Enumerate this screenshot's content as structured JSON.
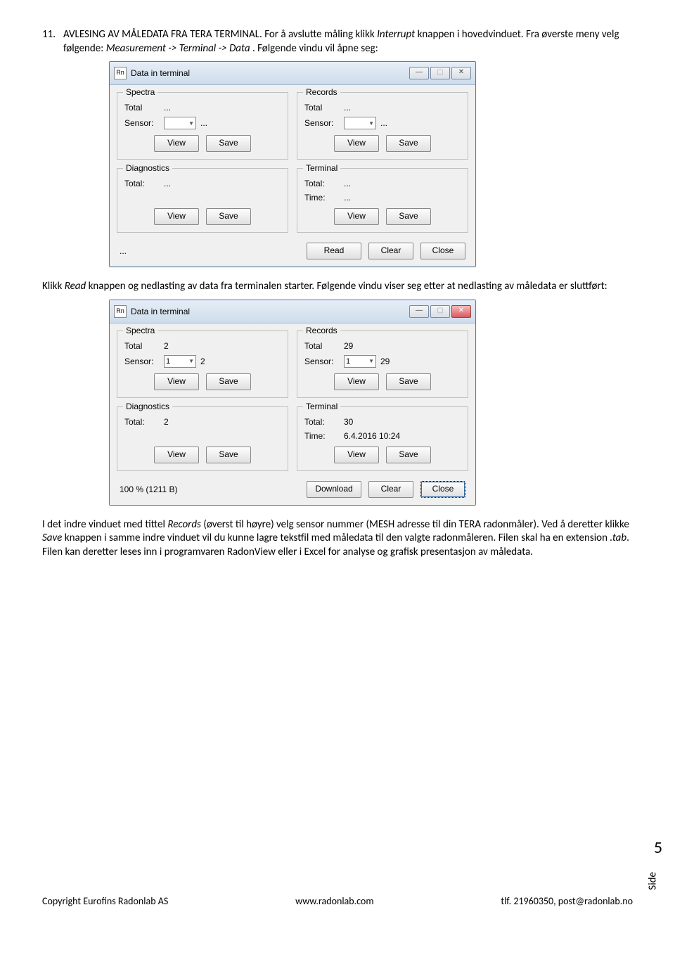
{
  "para1": {
    "num": "11.",
    "t1": "AVLESING AV MÅLEDATA FRA TERA TERMINAL. For å avslutte måling klikk ",
    "i1": "Interrupt",
    "t2": " knappen i hovedvinduet. Fra øverste meny velg følgende: ",
    "i2": "Measurement -> Terminal -> Data",
    "t3": " . Følgende vindu vil åpne seg:"
  },
  "win1": {
    "icon": "Rn",
    "title": "Data in terminal",
    "spectra": {
      "legend": "Spectra",
      "total_lbl": "Total",
      "total_val": "...",
      "sensor_lbl": "Sensor:",
      "sensor_sel": "",
      "sensor_after": "...",
      "view": "View",
      "save": "Save"
    },
    "records": {
      "legend": "Records",
      "total_lbl": "Total",
      "total_val": "...",
      "sensor_lbl": "Sensor:",
      "sensor_sel": "",
      "sensor_after": "...",
      "view": "View",
      "save": "Save"
    },
    "diag": {
      "legend": "Diagnostics",
      "total_lbl": "Total:",
      "total_val": "...",
      "view": "View",
      "save": "Save"
    },
    "term": {
      "legend": "Terminal",
      "total_lbl": "Total:",
      "total_val": "...",
      "time_lbl": "Time:",
      "time_val": "...",
      "view": "View",
      "save": "Save"
    },
    "status": "...",
    "read": "Read",
    "clear": "Clear",
    "close": "Close"
  },
  "para2": {
    "t1": "Klikk ",
    "i1": "Read",
    "t2": " knappen og nedlasting av data fra terminalen starter. Følgende vindu viser seg etter at nedlasting av måledata er sluttført:"
  },
  "win2": {
    "icon": "Rn",
    "title": "Data in terminal",
    "spectra": {
      "legend": "Spectra",
      "total_lbl": "Total",
      "total_val": "2",
      "sensor_lbl": "Sensor:",
      "sensor_sel": "1",
      "sensor_after": "2",
      "view": "View",
      "save": "Save"
    },
    "records": {
      "legend": "Records",
      "total_lbl": "Total",
      "total_val": "29",
      "sensor_lbl": "Sensor:",
      "sensor_sel": "1",
      "sensor_after": "29",
      "view": "View",
      "save": "Save"
    },
    "diag": {
      "legend": "Diagnostics",
      "total_lbl": "Total:",
      "total_val": "2",
      "view": "View",
      "save": "Save"
    },
    "term": {
      "legend": "Terminal",
      "total_lbl": "Total:",
      "total_val": "30",
      "time_lbl": "Time:",
      "time_val": "6.4.2016  10:24",
      "view": "View",
      "save": "Save"
    },
    "status": "100 % (1211 B)",
    "read": "Download",
    "clear": "Clear",
    "close": "Close"
  },
  "para3": {
    "t1": "I det indre vinduet med tittel ",
    "i1": "Records",
    "t2": " (øverst til høyre) velg sensor nummer (MESH adresse til din TERA radonmåler). Ved å deretter klikke ",
    "i2": "Save",
    "t3": " knappen i samme indre vinduet vil du kunne lagre tekstfil med måledata til den valgte radonmåleren. Filen skal ha en extension ",
    "i3": ".tab",
    "t4": ". Filen kan deretter leses inn i programvaren RadonView eller i Excel for analyse og grafisk presentasjon av måledata."
  },
  "sidelabel": "Side",
  "sidenum": "5",
  "footer": {
    "left": "Copyright Eurofins Radonlab AS",
    "center": "www.radonlab.com",
    "right": "tlf. 21960350, post@radonlab.no"
  }
}
